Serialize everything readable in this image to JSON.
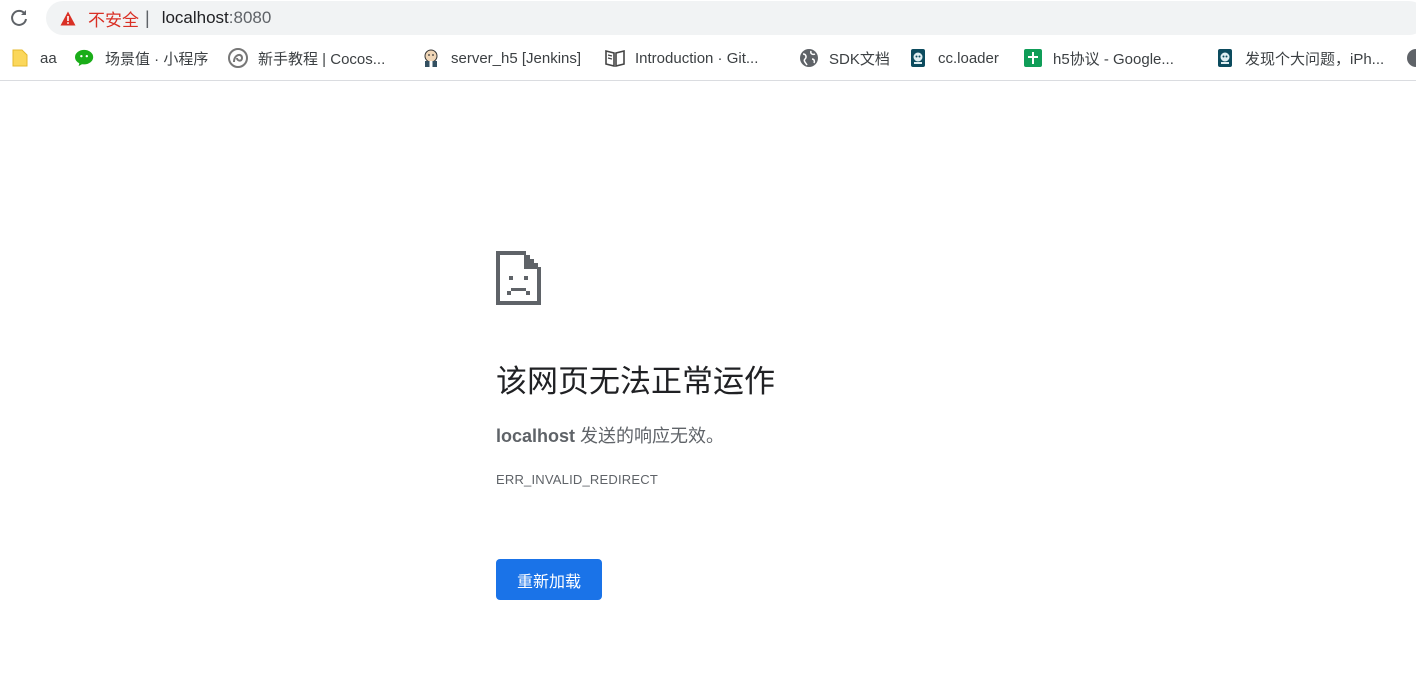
{
  "toolbar": {
    "reload_icon": "reload-icon",
    "security_icon": "warning-triangle-icon",
    "security_label": "不安全",
    "divider": "|",
    "url_host": "localhost",
    "url_port": ":8080"
  },
  "bookmarks": [
    {
      "label": "aa",
      "icon": "folder-icon"
    },
    {
      "label": "场景值 · 小程序",
      "icon": "wechat-icon"
    },
    {
      "label": "新手教程 | Cocos...",
      "icon": "cocos-icon"
    },
    {
      "label": "server_h5 [Jenkins]",
      "icon": "jenkins-icon"
    },
    {
      "label": "Introduction · Git...",
      "icon": "book-icon"
    },
    {
      "label": "SDK文档",
      "icon": "globe-icon"
    },
    {
      "label": "cc.loader",
      "icon": "cocos-doc-icon"
    },
    {
      "label": "h5协议 - Google...",
      "icon": "google-sheets-icon"
    },
    {
      "label": "发现个大问题，iPh...",
      "icon": "cocos-doc-icon"
    }
  ],
  "error": {
    "icon": "sad-document-icon",
    "title": "该网页无法正常运作",
    "host": "localhost",
    "description_suffix": " 发送的响应无效。",
    "code": "ERR_INVALID_REDIRECT",
    "reload_button_label": "重新加载"
  },
  "colors": {
    "accent": "#1a73e8",
    "warning": "#d93025",
    "omnibox_bg": "#f1f3f4",
    "text_secondary": "#5f6368"
  }
}
